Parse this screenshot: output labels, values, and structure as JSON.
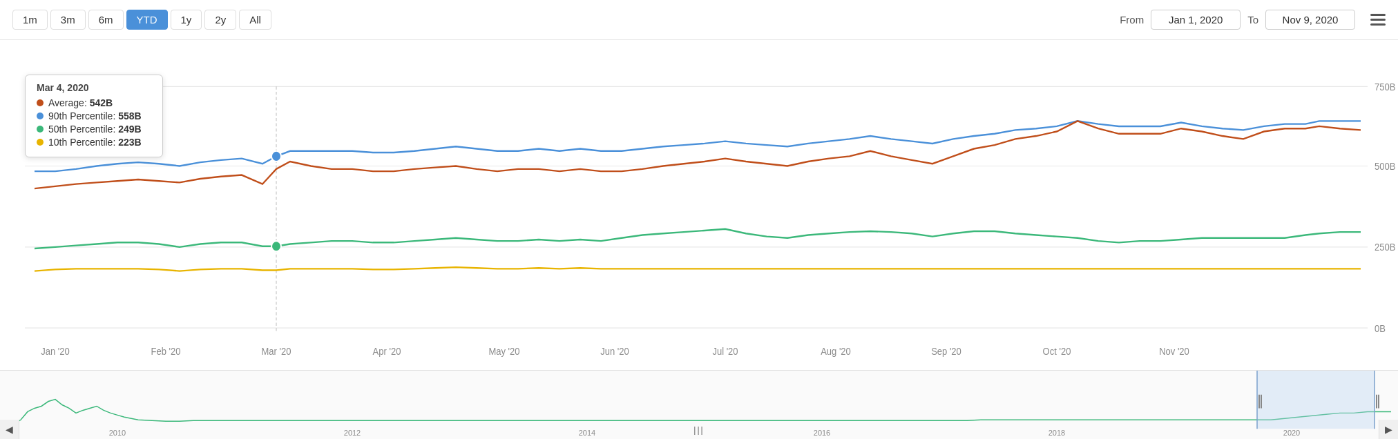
{
  "timeButtons": [
    {
      "label": "1m",
      "active": false
    },
    {
      "label": "3m",
      "active": false
    },
    {
      "label": "6m",
      "active": false
    },
    {
      "label": "YTD",
      "active": true
    },
    {
      "label": "1y",
      "active": false
    },
    {
      "label": "2y",
      "active": false
    },
    {
      "label": "All",
      "active": false
    }
  ],
  "fromLabel": "From",
  "toLabel": "To",
  "fromDate": "Jan 1, 2020",
  "toDate": "Nov 9, 2020",
  "tooltip": {
    "date": "Mar 4, 2020",
    "rows": [
      {
        "color": "#c04e1a",
        "label": "Average: ",
        "value": "542B"
      },
      {
        "color": "#4a90d9",
        "label": "90th Percentile: ",
        "value": "558B"
      },
      {
        "color": "#3bb87a",
        "label": "50th Percentile: ",
        "value": "249B"
      },
      {
        "color": "#e8b400",
        "label": "10th Percentile: ",
        "value": "223B"
      }
    ]
  },
  "yAxisLabels": [
    "750B",
    "500B",
    "250B",
    "0B"
  ],
  "xAxisLabels": [
    "Jan '20",
    "Feb '20",
    "Mar '20",
    "Apr '20",
    "May '20",
    "Jun '20",
    "Jul '20",
    "Aug '20",
    "Sep '20",
    "Oct '20",
    "Nov '20"
  ],
  "miniXLabels": [
    "2010",
    "2012",
    "2014",
    "2016",
    "2018",
    "2020"
  ],
  "colors": {
    "blue": "#4a90d9",
    "orange": "#c04e1a",
    "green": "#3bb87a",
    "yellow": "#e8b400",
    "gridLine": "#e8e8e8",
    "crosshair": "#aaa"
  }
}
